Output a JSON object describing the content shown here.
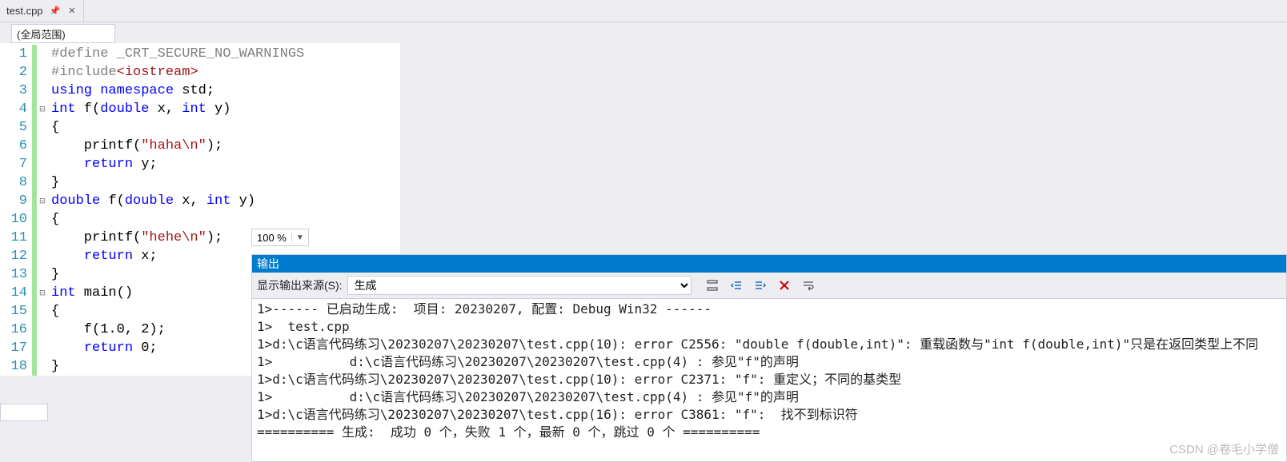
{
  "tab": {
    "filename": "test.cpp"
  },
  "scope": {
    "label": "(全局范围)"
  },
  "zoom": {
    "value": "100 %"
  },
  "code": {
    "lines": [
      {
        "n": 1,
        "fold": "",
        "segs": [
          {
            "c": "dir",
            "t": "#define _CRT_SECURE_NO_WARNINGS"
          }
        ]
      },
      {
        "n": 2,
        "fold": "",
        "segs": [
          {
            "c": "dir",
            "t": "#include"
          },
          {
            "c": "str",
            "t": "<iostream>"
          }
        ]
      },
      {
        "n": 3,
        "fold": "",
        "segs": [
          {
            "c": "kw",
            "t": "using"
          },
          {
            "c": "",
            "t": " "
          },
          {
            "c": "kw",
            "t": "namespace"
          },
          {
            "c": "",
            "t": " std;"
          }
        ]
      },
      {
        "n": 4,
        "fold": "⊟",
        "segs": [
          {
            "c": "kw",
            "t": "int"
          },
          {
            "c": "",
            "t": " f("
          },
          {
            "c": "kw",
            "t": "double"
          },
          {
            "c": "",
            "t": " x, "
          },
          {
            "c": "kw",
            "t": "int"
          },
          {
            "c": "",
            "t": " y)"
          }
        ]
      },
      {
        "n": 5,
        "fold": "",
        "segs": [
          {
            "c": "",
            "t": "{"
          }
        ]
      },
      {
        "n": 6,
        "fold": "",
        "segs": [
          {
            "c": "",
            "t": "    printf("
          },
          {
            "c": "str",
            "t": "\"haha\\n\""
          },
          {
            "c": "",
            "t": ");"
          }
        ]
      },
      {
        "n": 7,
        "fold": "",
        "segs": [
          {
            "c": "",
            "t": "    "
          },
          {
            "c": "kw",
            "t": "return"
          },
          {
            "c": "",
            "t": " y;"
          }
        ]
      },
      {
        "n": 8,
        "fold": "",
        "segs": [
          {
            "c": "",
            "t": "}"
          }
        ]
      },
      {
        "n": 9,
        "fold": "⊟",
        "segs": [
          {
            "c": "kw",
            "t": "double"
          },
          {
            "c": "",
            "t": " f("
          },
          {
            "c": "kw",
            "t": "double"
          },
          {
            "c": "",
            "t": " x, "
          },
          {
            "c": "kw",
            "t": "int"
          },
          {
            "c": "",
            "t": " y)"
          }
        ]
      },
      {
        "n": 10,
        "fold": "",
        "segs": [
          {
            "c": "",
            "t": "{"
          }
        ]
      },
      {
        "n": 11,
        "fold": "",
        "segs": [
          {
            "c": "",
            "t": "    printf("
          },
          {
            "c": "str",
            "t": "\"hehe\\n\""
          },
          {
            "c": "",
            "t": ");"
          }
        ]
      },
      {
        "n": 12,
        "fold": "",
        "segs": [
          {
            "c": "",
            "t": "    "
          },
          {
            "c": "kw",
            "t": "return"
          },
          {
            "c": "",
            "t": " x;"
          }
        ]
      },
      {
        "n": 13,
        "fold": "",
        "segs": [
          {
            "c": "",
            "t": "}"
          }
        ]
      },
      {
        "n": 14,
        "fold": "⊟",
        "segs": [
          {
            "c": "kw",
            "t": "int"
          },
          {
            "c": "",
            "t": " main()"
          }
        ]
      },
      {
        "n": 15,
        "fold": "",
        "segs": [
          {
            "c": "",
            "t": "{"
          }
        ]
      },
      {
        "n": 16,
        "fold": "",
        "segs": [
          {
            "c": "",
            "t": "    f(1.0, 2);"
          }
        ]
      },
      {
        "n": 17,
        "fold": "",
        "segs": [
          {
            "c": "",
            "t": "    "
          },
          {
            "c": "kw",
            "t": "return"
          },
          {
            "c": "",
            "t": " 0;"
          }
        ]
      },
      {
        "n": 18,
        "fold": "",
        "segs": [
          {
            "c": "",
            "t": "}"
          }
        ]
      }
    ]
  },
  "output": {
    "title": "输出",
    "source_label": "显示输出来源(S):",
    "source_value": "生成",
    "lines": [
      "1>------ 已启动生成:  项目: 20230207, 配置: Debug Win32 ------",
      "1>  test.cpp",
      "1>d:\\c语言代码练习\\20230207\\20230207\\test.cpp(10): error C2556: \"double f(double,int)\": 重载函数与\"int f(double,int)\"只是在返回类型上不同",
      "1>          d:\\c语言代码练习\\20230207\\20230207\\test.cpp(4) : 参见\"f\"的声明",
      "1>d:\\c语言代码练习\\20230207\\20230207\\test.cpp(10): error C2371: \"f\": 重定义；不同的基类型",
      "1>          d:\\c语言代码练习\\20230207\\20230207\\test.cpp(4) : 参见\"f\"的声明",
      "1>d:\\c语言代码练习\\20230207\\20230207\\test.cpp(16): error C3861: \"f\":  找不到标识符",
      "========== 生成:  成功 0 个，失败 1 个，最新 0 个，跳过 0 个 =========="
    ]
  },
  "watermark": "CSDN @卷毛小学僧"
}
